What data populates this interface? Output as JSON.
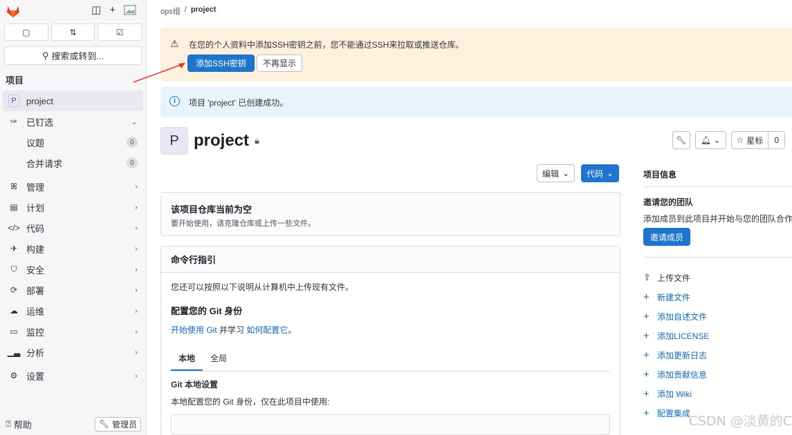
{
  "sidebar": {
    "tabs": [
      "",
      "",
      ""
    ],
    "search_label": "搜索或转到...",
    "section_title": "项目",
    "project_initial": "P",
    "project_name": "project",
    "pinned_label": "已钉选",
    "pinned_items": [
      {
        "label": "议题",
        "count": "0"
      },
      {
        "label": "合并请求",
        "count": "0"
      }
    ],
    "nav_items": [
      {
        "label": "管理",
        "icon": "users-icon"
      },
      {
        "label": "计划",
        "icon": "calendar-icon"
      },
      {
        "label": "代码",
        "icon": "code-icon"
      },
      {
        "label": "构建",
        "icon": "rocket-icon"
      },
      {
        "label": "安全",
        "icon": "shield-icon"
      },
      {
        "label": "部署",
        "icon": "deploy-icon"
      },
      {
        "label": "运维",
        "icon": "cloud-icon"
      },
      {
        "label": "监控",
        "icon": "monitor-icon"
      },
      {
        "label": "分析",
        "icon": "chart-icon"
      },
      {
        "label": "设置",
        "icon": "gear-icon"
      }
    ],
    "help_label": "帮助",
    "admin_label": "管理员"
  },
  "breadcrumb": {
    "group": "ops组",
    "separator": "/",
    "current": "project"
  },
  "alert_warning": {
    "text": "在您的个人资料中添加SSH密钥之前，您不能通过SSH来拉取或推送仓库。",
    "primary_button": "添加SSH密钥",
    "secondary_button": "不再显示"
  },
  "alert_info": {
    "text": "项目 'project' 已创建成功。"
  },
  "project": {
    "initial": "P",
    "title": "project",
    "star_label": "星标",
    "star_count": "0",
    "edit_label": "编辑",
    "code_label": "代码"
  },
  "empty_repo": {
    "title": "该项目仓库当前为空",
    "subtitle": "要开始使用，请克隆仓库或上传一些文件。"
  },
  "cli": {
    "title": "命令行指引",
    "intro": "您还可以按照以下说明从计算机中上传现有文件。",
    "identity_title": "配置您的 Git 身份",
    "link1": "开始使用 Git",
    "mid_text": " 并学习 ",
    "link2": "如何配置它",
    "end_text": "。",
    "tabs": [
      "本地",
      "全局"
    ],
    "local_title": "Git 本地设置",
    "local_desc": "本地配置您的 Git 身份，仅在此项目中使用:"
  },
  "right_panel": {
    "title": "项目信息",
    "invite_title": "邀请您的团队",
    "invite_desc": "添加成员到此项目并开始与您的团队合作。",
    "invite_button": "邀请成员",
    "upload_label": "上传文件",
    "actions": [
      "新建文件",
      "添加自述文件",
      "添加LICENSE",
      "添加更新日志",
      "添加贡献信息",
      "添加 Wiki",
      "配置集成"
    ]
  },
  "watermark": "CSDN @淡黄的C"
}
